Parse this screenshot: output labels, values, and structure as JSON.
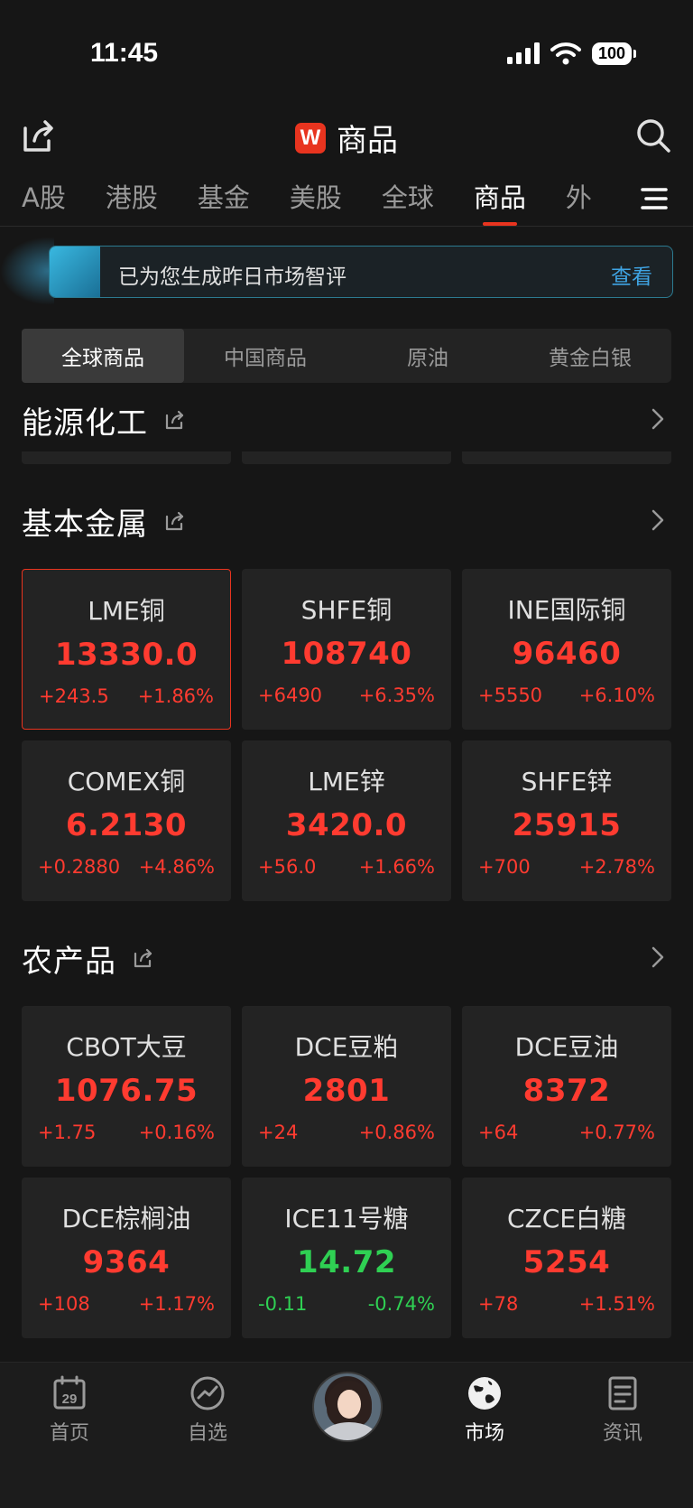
{
  "status_bar": {
    "time": "11:45",
    "battery": "100"
  },
  "header": {
    "logo_letter": "W",
    "title": "商品"
  },
  "tabs": [
    {
      "label": "A股",
      "active": false
    },
    {
      "label": "港股",
      "active": false
    },
    {
      "label": "基金",
      "active": false
    },
    {
      "label": "美股",
      "active": false
    },
    {
      "label": "全球",
      "active": false
    },
    {
      "label": "商品",
      "active": true
    },
    {
      "label": "外",
      "active": false
    }
  ],
  "banner": {
    "text": "已为您生成昨日市场智评",
    "link": "查看"
  },
  "segments": [
    {
      "label": "全球商品",
      "active": true
    },
    {
      "label": "中国商品",
      "active": false
    },
    {
      "label": "原油",
      "active": false
    },
    {
      "label": "黄金白银",
      "active": false
    }
  ],
  "sections": {
    "energy": {
      "title": "能源化工"
    },
    "metals": {
      "title": "基本金属",
      "items": [
        {
          "name": "LME铜",
          "price": "13330.0",
          "change": "+243.5",
          "pct": "+1.86%",
          "trend": "up"
        },
        {
          "name": "SHFE铜",
          "price": "108740",
          "change": "+6490",
          "pct": "+6.35%",
          "trend": "up"
        },
        {
          "name": "INE国际铜",
          "price": "96460",
          "change": "+5550",
          "pct": "+6.10%",
          "trend": "up"
        },
        {
          "name": "COMEX铜",
          "price": "6.2130",
          "change": "+0.2880",
          "pct": "+4.86%",
          "trend": "up"
        },
        {
          "name": "LME锌",
          "price": "3420.0",
          "change": "+56.0",
          "pct": "+1.66%",
          "trend": "up"
        },
        {
          "name": "SHFE锌",
          "price": "25915",
          "change": "+700",
          "pct": "+2.78%",
          "trend": "up"
        }
      ]
    },
    "agri": {
      "title": "农产品",
      "items": [
        {
          "name": "CBOT大豆",
          "price": "1076.75",
          "change": "+1.75",
          "pct": "+0.16%",
          "trend": "up"
        },
        {
          "name": "DCE豆粕",
          "price": "2801",
          "change": "+24",
          "pct": "+0.86%",
          "trend": "up"
        },
        {
          "name": "DCE豆油",
          "price": "8372",
          "change": "+64",
          "pct": "+0.77%",
          "trend": "up"
        },
        {
          "name": "DCE棕榈油",
          "price": "9364",
          "change": "+108",
          "pct": "+1.17%",
          "trend": "up"
        },
        {
          "name": "ICE11号糖",
          "price": "14.72",
          "change": "-0.11",
          "pct": "-0.74%",
          "trend": "down"
        },
        {
          "name": "CZCE白糖",
          "price": "5254",
          "change": "+78",
          "pct": "+1.51%",
          "trend": "up"
        }
      ]
    }
  },
  "bottom_nav": {
    "home": {
      "label": "首页",
      "date": "29"
    },
    "watchlist": {
      "label": "自选"
    },
    "market": {
      "label": "市场"
    },
    "news": {
      "label": "资讯"
    }
  },
  "colors": {
    "up": "#ff3b30",
    "down": "#2fd053",
    "accent": "#e8341f",
    "link": "#3fa4e3"
  }
}
